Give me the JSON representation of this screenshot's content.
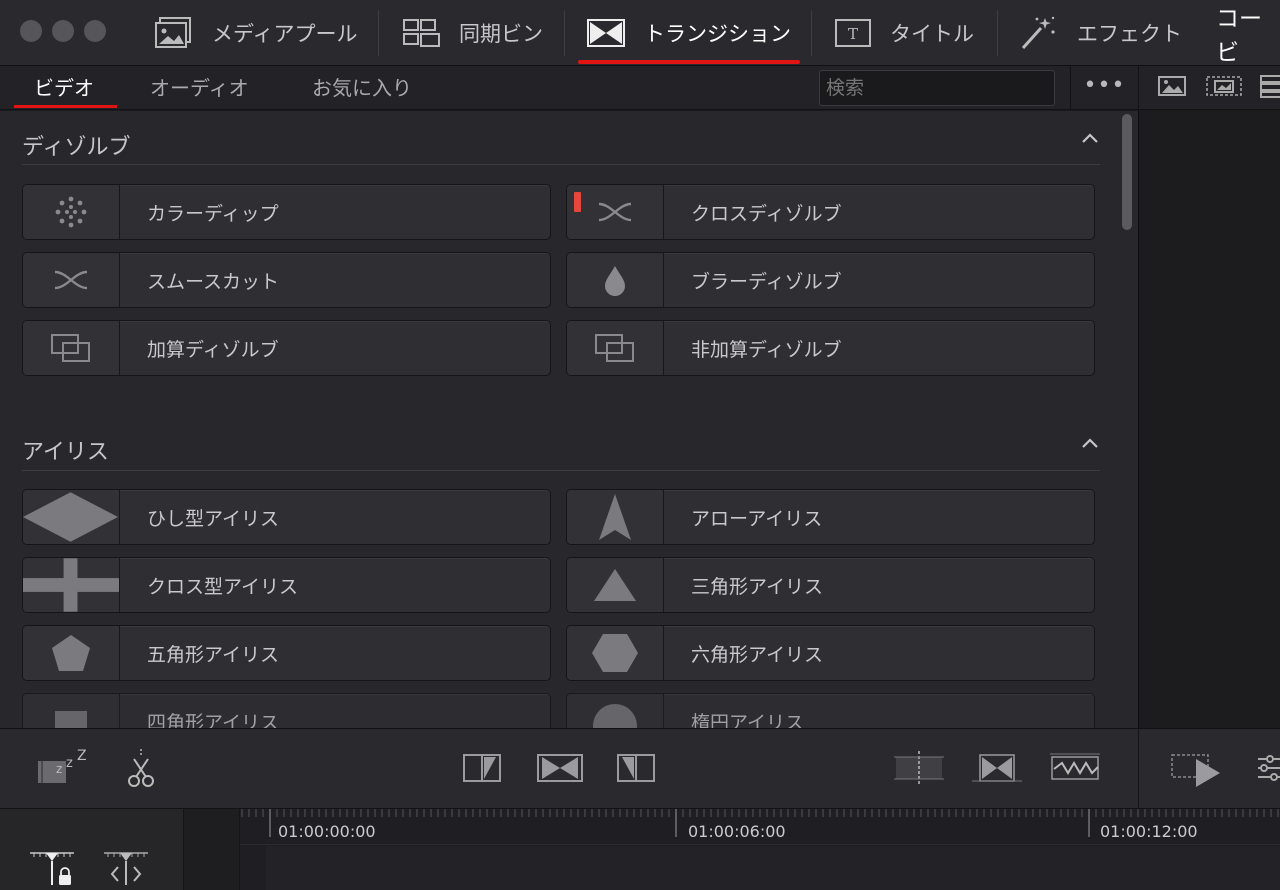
{
  "toolbar": {
    "tabs": [
      {
        "label": "メディアプール",
        "icon": "image-icon"
      },
      {
        "label": "同期ビン",
        "icon": "sync-bin-icon"
      },
      {
        "label": "トランジション",
        "icon": "transition-icon",
        "active": true
      },
      {
        "label": "タイトル",
        "icon": "title-icon"
      },
      {
        "label": "エフェクト",
        "icon": "magic-wand-icon"
      },
      {
        "label": "コービ"
      }
    ],
    "accent": "#e11414"
  },
  "subtabs": {
    "items": [
      "ビデオ",
      "オーディオ",
      "お気に入り"
    ],
    "active": "ビデオ"
  },
  "search": {
    "placeholder": "検索"
  },
  "more_label": "•••",
  "sections": [
    {
      "title": "ディゾルブ",
      "items": [
        {
          "label": "カラーディップ",
          "icon": "dots-circle-icon"
        },
        {
          "label": "クロスディゾルブ",
          "icon": "cross-wave-icon",
          "favorite": true
        },
        {
          "label": "スムースカット",
          "icon": "cross-wave-icon"
        },
        {
          "label": "ブラーディゾルブ",
          "icon": "droplet-icon"
        },
        {
          "label": "加算ディゾルブ",
          "icon": "overlap-rects-icon"
        },
        {
          "label": "非加算ディゾルブ",
          "icon": "overlap-rects-icon"
        }
      ]
    },
    {
      "title": "アイリス",
      "items": [
        {
          "label": "ひし型アイリス",
          "icon": "diamond-icon"
        },
        {
          "label": "アローアイリス",
          "icon": "arrow-icon"
        },
        {
          "label": "クロス型アイリス",
          "icon": "plus-icon"
        },
        {
          "label": "三角形アイリス",
          "icon": "triangle-icon"
        },
        {
          "label": "五角形アイリス",
          "icon": "pentagon-icon"
        },
        {
          "label": "六角形アイリス",
          "icon": "hexagon-icon"
        },
        {
          "label": "四角形アイリス",
          "icon": "square-icon"
        },
        {
          "label": "楕円アイリス",
          "icon": "circle-icon"
        }
      ]
    }
  ],
  "timeline": {
    "timecodes": [
      "01:00:00:00",
      "01:00:06:00",
      "01:00:12:00"
    ]
  },
  "colors": {
    "accent_red": "#e11414",
    "favorite_marker": "#e6463c"
  }
}
